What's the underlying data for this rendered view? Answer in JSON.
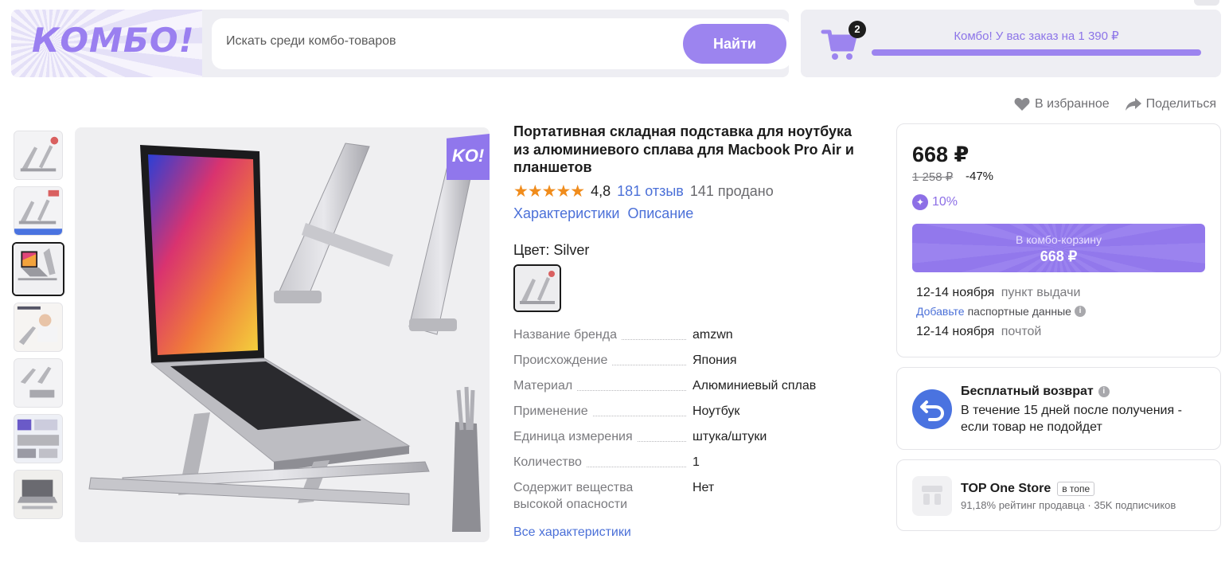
{
  "header": {
    "logo_text": "КОМБО!",
    "search_placeholder": "Искать среди комбо-товаров",
    "search_button": "Найти",
    "cart_count": "2",
    "combo_message": "Комбо! У вас заказ на 1 390 ₽",
    "combo_progress": 1.0
  },
  "actions": {
    "favorite": "В избранное",
    "share": "Поделиться"
  },
  "gallery": {
    "thumbnail_count": 7,
    "active_index": 2,
    "badge": "KO!"
  },
  "product": {
    "title": "Портативная складная подставка для ноутбука из алюминиевого сплава для Macbook Pro Air и планшетов",
    "stars": "★★★★★",
    "rating": "4,8",
    "reviews": "181 отзыв",
    "sold": "141 продано",
    "tab_specs": "Характеристики",
    "tab_description": "Описание",
    "color_label": "Цвет: Silver",
    "specs": [
      {
        "key": "Название бренда",
        "value": "amzwn"
      },
      {
        "key": "Происхождение",
        "value": "Япония"
      },
      {
        "key": "Материал",
        "value": "Алюминиевый сплав"
      },
      {
        "key": "Применение",
        "value": "Ноутбук"
      },
      {
        "key": "Единица измерения",
        "value": "штука/штуки"
      },
      {
        "key": "Количество",
        "value": "1"
      },
      {
        "key": "Содержит вещества высокой опасности",
        "value": "Нет"
      }
    ],
    "all_specs_link": "Все характеристики"
  },
  "price_card": {
    "price": "668 ₽",
    "old_price": "1 258 ₽",
    "discount": "-47%",
    "cashback": "10%",
    "cart_button_line1": "В комбо-корзину",
    "cart_button_line2": "668 ₽",
    "delivery1_date": "12-14 ноября",
    "delivery1_method": "пункт выдачи",
    "passport_link": "Добавьте",
    "passport_text": "паспортные данные",
    "delivery2_date": "12-14 ноября",
    "delivery2_method": "почтой"
  },
  "return_card": {
    "title": "Бесплатный возврат",
    "text": "В течение 15 дней после получения - если товар не подойдет"
  },
  "store_card": {
    "name": "TOP One Store",
    "badge": "в топе",
    "meta": "91,18% рейтинг продавца · 35K подписчиков"
  },
  "colors": {
    "accent": "#9c84ef",
    "link": "#4b70d8",
    "star": "#f08c1c"
  }
}
